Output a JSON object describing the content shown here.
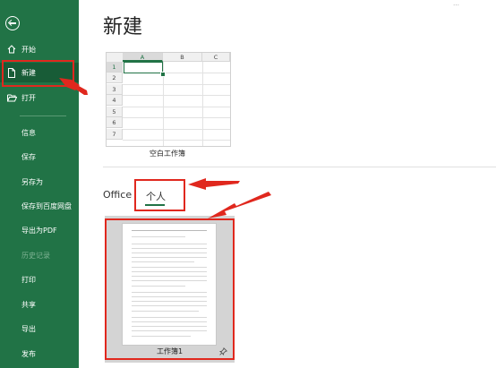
{
  "sidebar": {
    "back_label": "",
    "items": [
      {
        "label": "开始",
        "icon": "home-icon"
      },
      {
        "label": "新建",
        "icon": "new-file-icon"
      },
      {
        "label": "打开",
        "icon": "open-folder-icon"
      },
      {
        "label": "信息"
      },
      {
        "label": "保存"
      },
      {
        "label": "另存为"
      },
      {
        "label": "保存到百度网盘"
      },
      {
        "label": "导出为PDF"
      },
      {
        "label": "历史记录"
      },
      {
        "label": "打印"
      },
      {
        "label": "共享"
      },
      {
        "label": "导出"
      },
      {
        "label": "发布"
      }
    ]
  },
  "main": {
    "title": "新建",
    "top_mark": "…",
    "blank_workbook": {
      "label": "空白工作簿",
      "columns": [
        "A",
        "B",
        "C"
      ],
      "rows": [
        "1",
        "2",
        "3",
        "4",
        "5",
        "6",
        "7"
      ]
    },
    "tabs": [
      {
        "label": "Office"
      },
      {
        "label": "个人",
        "selected": true
      }
    ],
    "template": {
      "name": "工作簿1",
      "pin_icon": "pin-icon"
    }
  },
  "colors": {
    "sidebar_bg": "#217346",
    "sidebar_active": "#185c37",
    "annotation_red": "#e0281e",
    "accent_green": "#217346"
  }
}
